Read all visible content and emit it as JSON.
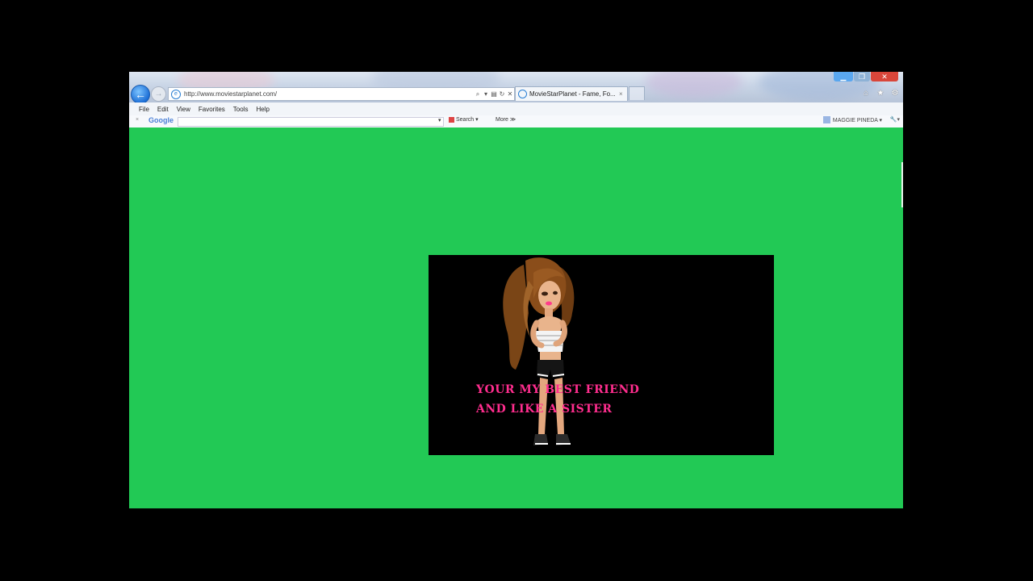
{
  "browser": {
    "address": {
      "url": "http://www.moviestarplanet.com/"
    },
    "tab": {
      "title": "MovieStarPlanet - Fame, Fo...",
      "close": "×"
    },
    "menu": [
      "File",
      "Edit",
      "View",
      "Favorites",
      "Tools",
      "Help"
    ],
    "google_toolbar": {
      "close": "×",
      "logo": "Google",
      "search_label": "Search ▾",
      "more_label": "More ≫",
      "user_label": "MAGGIE PINEDA ▾"
    },
    "caption_buttons": [
      "minimize",
      "maximize",
      "close"
    ],
    "icons": [
      "back-arrow-icon",
      "forward-arrow-icon",
      "ie-icon",
      "home-icon",
      "star-icon",
      "gear-icon"
    ]
  },
  "page": {
    "background_color": "#22c955",
    "video": {
      "caption_line1": "YOUR MY BEST FRIEND",
      "caption_line2": "AND LIKE A SISTER",
      "caption_color": "#ff2d8e"
    }
  }
}
